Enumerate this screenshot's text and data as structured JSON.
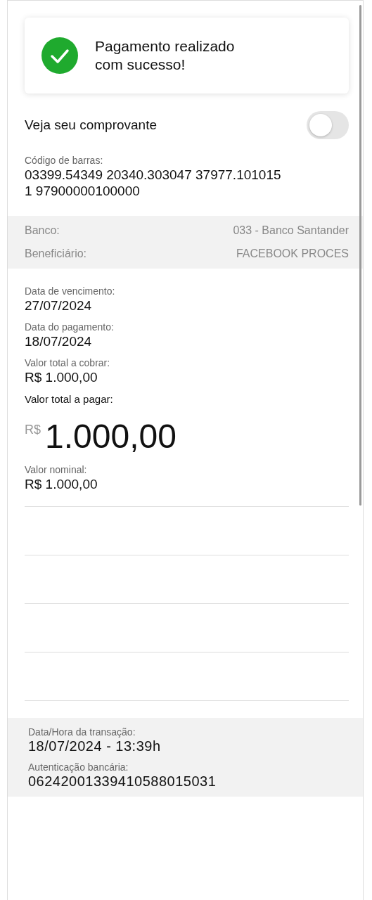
{
  "banner": {
    "message": "Pagamento realizado com sucesso!"
  },
  "receipt_toggle": {
    "label": "Veja seu comprovante",
    "on": false
  },
  "barcode": {
    "label": "Código de barras:",
    "lines": [
      "03399.54349 20340.303047 37977.101015",
      "1 97900000100000"
    ]
  },
  "details": [
    {
      "label": "Banco:",
      "value": "033 - Banco Santander"
    },
    {
      "label": "Beneficiário:",
      "value": "FACEBOOK PROCES"
    }
  ],
  "dates": [
    {
      "label": "Data de vencimento:",
      "value": "27/07/2024"
    },
    {
      "label": "Data do pagamento:",
      "value": "18/07/2024"
    },
    {
      "label": "Valor total a cobrar:",
      "value": "R$  1.000,00"
    }
  ],
  "total": {
    "label": "Valor total a pagar:",
    "currency": "R$",
    "amount": "1.000,00"
  },
  "nominal": {
    "label": "Valor nominal:",
    "value": "R$  1.000,00"
  },
  "transaction": [
    {
      "label": "Data/Hora da transação:",
      "value": "18/07/2024 - 13:39h"
    },
    {
      "label": "Autenticação bancária:",
      "value": "06242001339410588015031"
    }
  ]
}
